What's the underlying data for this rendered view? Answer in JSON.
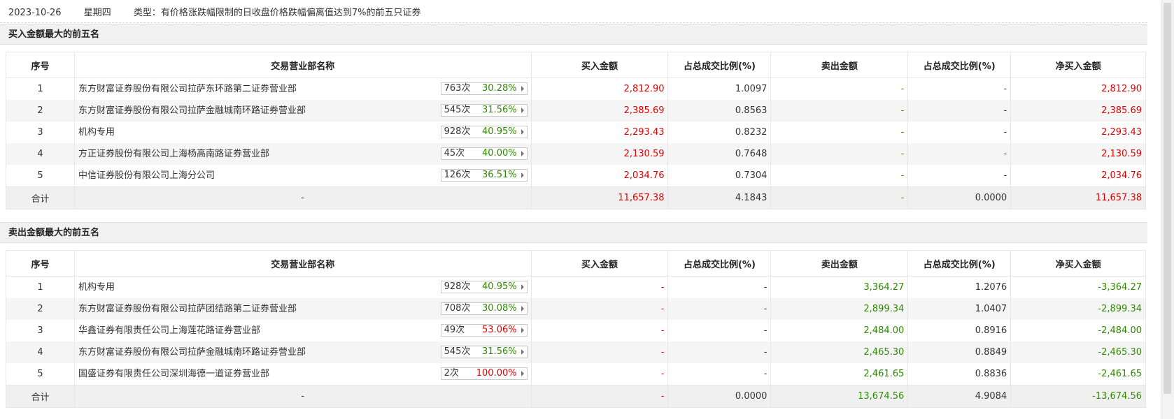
{
  "header": {
    "date": "2023-10-26",
    "weekday": "星期四",
    "type": "类型：有价格涨跌幅限制的日收盘价格跌幅偏离值达到7%的前五只证券"
  },
  "columns": [
    "序号",
    "交易营业部名称",
    "买入金额",
    "占总成交比例(%)",
    "卖出金额",
    "占总成交比例(%)",
    "净买入金额"
  ],
  "colors": {
    "up": "#e10000",
    "down": "#2d8a00"
  },
  "icons": {
    "stat_arrow": "caret-right-icon"
  },
  "buy_section": {
    "title": "买入金额最大的前五名",
    "rows": [
      {
        "idx": "1",
        "name": "东方财富证券股份有限公司拉萨东环路第二证券营业部",
        "count": "763次",
        "pct": "30.28%",
        "pct_color": "green",
        "buy": "2,812.90",
        "buy_ratio": "1.0097",
        "sell": "-",
        "sell_ratio": "-",
        "net": "2,812.90",
        "net_color": "red"
      },
      {
        "idx": "2",
        "name": "东方财富证券股份有限公司拉萨金融城南环路证券营业部",
        "count": "545次",
        "pct": "31.56%",
        "pct_color": "green",
        "buy": "2,385.69",
        "buy_ratio": "0.8563",
        "sell": "-",
        "sell_ratio": "-",
        "net": "2,385.69",
        "net_color": "red"
      },
      {
        "idx": "3",
        "name": "机构专用",
        "count": "928次",
        "pct": "40.95%",
        "pct_color": "green",
        "buy": "2,293.43",
        "buy_ratio": "0.8232",
        "sell": "-",
        "sell_ratio": "-",
        "net": "2,293.43",
        "net_color": "red"
      },
      {
        "idx": "4",
        "name": "方正证券股份有限公司上海杨高南路证券营业部",
        "count": "45次",
        "pct": "40.00%",
        "pct_color": "green",
        "buy": "2,130.59",
        "buy_ratio": "0.7648",
        "sell": "-",
        "sell_ratio": "-",
        "net": "2,130.59",
        "net_color": "red"
      },
      {
        "idx": "5",
        "name": "中信证券股份有限公司上海分公司",
        "count": "126次",
        "pct": "36.51%",
        "pct_color": "green",
        "buy": "2,034.76",
        "buy_ratio": "0.7304",
        "sell": "-",
        "sell_ratio": "-",
        "net": "2,034.76",
        "net_color": "red"
      }
    ],
    "total": {
      "label": "合计",
      "name": "-",
      "buy": "11,657.38",
      "buy_ratio": "4.1843",
      "sell": "-",
      "sell_ratio": "0.0000",
      "net": "11,657.38"
    }
  },
  "sell_section": {
    "title": "卖出金额最大的前五名",
    "rows": [
      {
        "idx": "1",
        "name": "机构专用",
        "count": "928次",
        "pct": "40.95%",
        "pct_color": "green",
        "buy": "-",
        "buy_ratio": "-",
        "sell": "3,364.27",
        "sell_ratio": "1.2076",
        "net": "-3,364.27",
        "net_color": "green"
      },
      {
        "idx": "2",
        "name": "东方财富证券股份有限公司拉萨团结路第二证券营业部",
        "count": "708次",
        "pct": "30.08%",
        "pct_color": "green",
        "buy": "-",
        "buy_ratio": "-",
        "sell": "2,899.34",
        "sell_ratio": "1.0407",
        "net": "-2,899.34",
        "net_color": "green"
      },
      {
        "idx": "3",
        "name": "华鑫证券有限责任公司上海莲花路证券营业部",
        "count": "49次",
        "pct": "53.06%",
        "pct_color": "red",
        "buy": "-",
        "buy_ratio": "-",
        "sell": "2,484.00",
        "sell_ratio": "0.8916",
        "net": "-2,484.00",
        "net_color": "green"
      },
      {
        "idx": "4",
        "name": "东方财富证券股份有限公司拉萨金融城南环路证券营业部",
        "count": "545次",
        "pct": "31.56%",
        "pct_color": "green",
        "buy": "-",
        "buy_ratio": "-",
        "sell": "2,465.30",
        "sell_ratio": "0.8849",
        "net": "-2,465.30",
        "net_color": "green"
      },
      {
        "idx": "5",
        "name": "国盛证券有限责任公司深圳海德一道证券营业部",
        "count": "2次",
        "pct": "100.00%",
        "pct_color": "red",
        "buy": "-",
        "buy_ratio": "-",
        "sell": "2,461.65",
        "sell_ratio": "0.8836",
        "net": "-2,461.65",
        "net_color": "green"
      }
    ],
    "total": {
      "label": "合计",
      "name": "-",
      "buy": "-",
      "buy_ratio": "0.0000",
      "sell": "13,674.56",
      "sell_ratio": "4.9084",
      "net": "-13,674.56"
    }
  }
}
